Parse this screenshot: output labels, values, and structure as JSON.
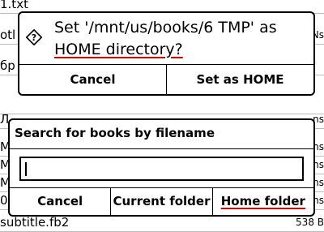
{
  "background": {
    "rows": [
      {
        "name": "1.txt",
        "size": ""
      },
      {
        "name": "otl",
        "size": "Ns"
      },
      {
        "name": "бр",
        "size": ""
      },
      {
        "name": "",
        "size": ""
      },
      {
        "name": "Л",
        "size": "ns"
      },
      {
        "name": "M",
        "size": "ns"
      },
      {
        "name": "M",
        "size": "ns"
      },
      {
        "name": "M",
        "size": "ns"
      },
      {
        "name": "0",
        "size": "ns"
      },
      {
        "name": "subtitle.fb2",
        "size": "538  B"
      }
    ]
  },
  "home_dialog": {
    "message_line1": "Set '/mnt/us/books/6 TMP' as",
    "message_line2": "HOME directory?",
    "cancel_label": "Cancel",
    "confirm_label": "Set as HOME"
  },
  "search_dialog": {
    "title": "Search for books by filename",
    "input_value": "",
    "cancel_label": "Cancel",
    "current_folder_label": "Current folder",
    "home_folder_label": "Home folder"
  },
  "colors": {
    "spell_underline": "#d00000"
  }
}
